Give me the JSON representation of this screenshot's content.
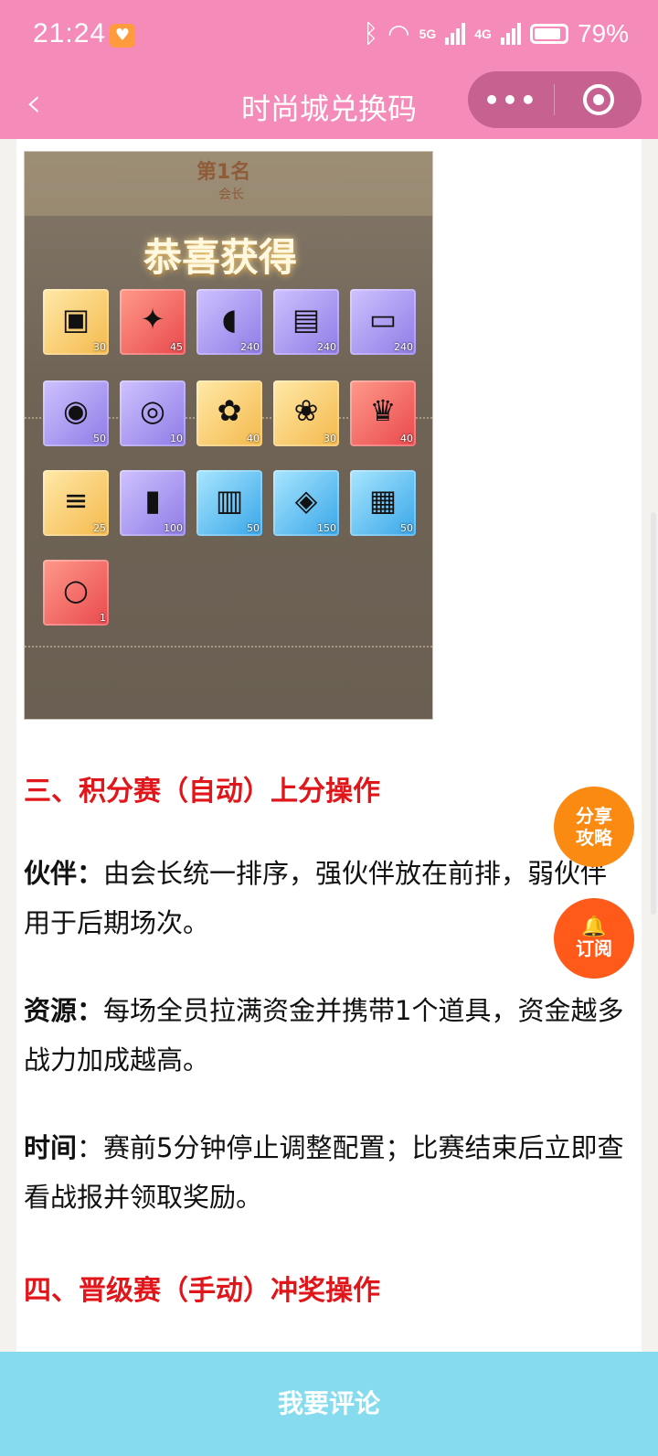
{
  "status_bar": {
    "time": "21:24",
    "signal_5g": "5G",
    "signal_4g": "4G",
    "battery": "79%"
  },
  "header": {
    "back_icon": "chevron-left-icon",
    "title": "时尚城兑换码",
    "more_icon": "more-dots-icon",
    "close_icon": "target-circle-icon"
  },
  "game_image": {
    "rank_text": "第1名",
    "rank_sub": "会长",
    "congrats": "恭喜获得",
    "rewards": [
      {
        "icon": "medal-frame-icon",
        "qty": "30"
      },
      {
        "icon": "ticket-icon",
        "qty": "45"
      },
      {
        "icon": "mouse-icon",
        "qty": "240"
      },
      {
        "icon": "keyboard-icon",
        "qty": "240"
      },
      {
        "icon": "monitor-icon",
        "qty": "240"
      },
      {
        "icon": "tire-icon",
        "qty": "50"
      },
      {
        "icon": "steering-wheel-icon",
        "qty": "10"
      },
      {
        "icon": "ribbon-icon",
        "qty": "40"
      },
      {
        "icon": "gift-box-icon",
        "qty": "30"
      },
      {
        "icon": "trophy-icon",
        "qty": "40"
      },
      {
        "icon": "scroll-icon",
        "qty": "25"
      },
      {
        "icon": "fuel-can-icon",
        "qty": "100"
      },
      {
        "icon": "notepad-icon",
        "qty": "50"
      },
      {
        "icon": "ticket-blue-icon",
        "qty": "150"
      },
      {
        "icon": "clipboard-icon",
        "qty": "50"
      },
      {
        "icon": "ring-frame-icon",
        "qty": "1"
      }
    ]
  },
  "article": {
    "section3_heading": "三、积分赛（自动）上分操作",
    "partner_label": "伙伴：",
    "partner_text": "由会长统一排序，强伙伴放在前排，弱伙伴用于后期场次。",
    "resource_label": "资源：",
    "resource_text": "每场全员拉满资金并携带1个道具，资金越多战力加成越高。",
    "time_label": "时间",
    "time_text": "：赛前5分钟停止调整配置；比赛结束后立即查看战报并领取奖励。",
    "section4_heading": "四、晋级赛（手动）冲奖操作"
  },
  "fab": {
    "share_line1": "分享",
    "share_line2": "攻略",
    "subscribe_label": "订阅",
    "subscribe_icon": "bell-icon"
  },
  "bottom_bar": {
    "comment_label": "我要评论"
  },
  "colors": {
    "header_pink": "#f48bb8",
    "heading_red": "#e0161a",
    "share_orange": "#fb8a12",
    "subscribe_orange": "#ff5a1a",
    "bottom_blue": "#86dcee"
  }
}
